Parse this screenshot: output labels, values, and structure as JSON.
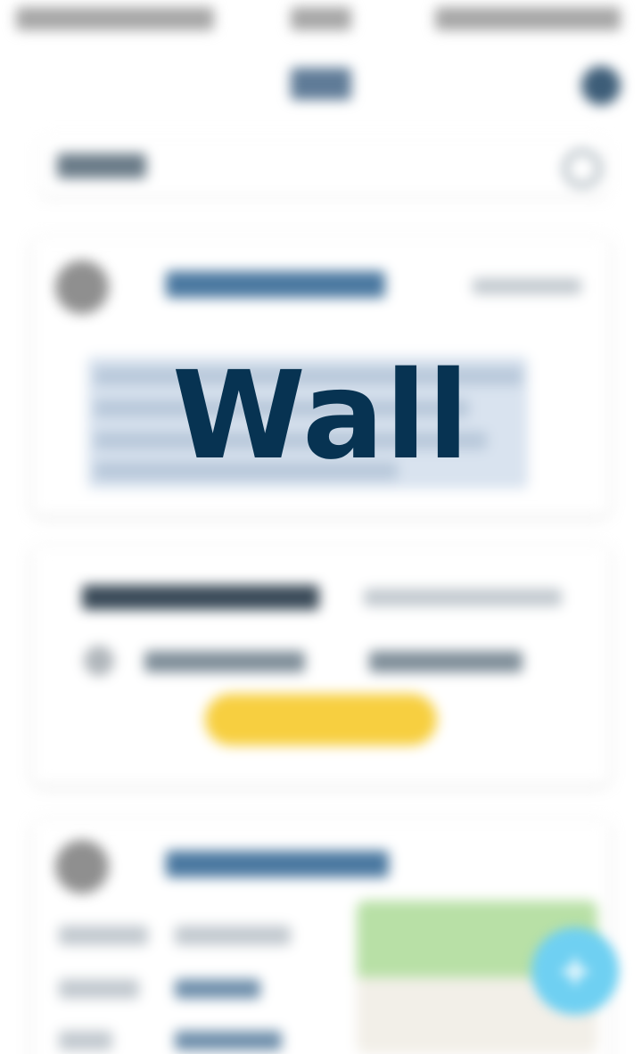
{
  "overlay": {
    "title": "Wall"
  },
  "icons": {
    "search": "search-icon",
    "add": "plus-icon",
    "profile": "profile-icon"
  },
  "fab": {
    "label": "+"
  },
  "colors": {
    "title": "#073352",
    "accent_blue": "#6fd0f2",
    "accent_yellow": "#f7cf40",
    "card_name": "#3b6a93"
  }
}
